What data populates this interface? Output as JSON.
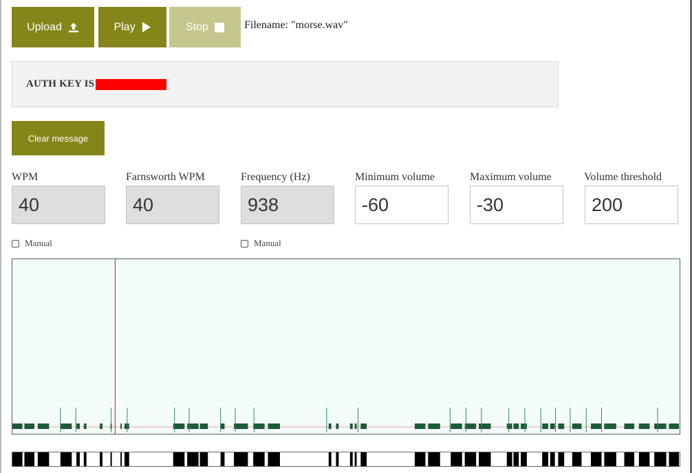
{
  "toolbar": {
    "upload_label": "Upload",
    "upload_icon": "upload-icon",
    "play_label": "Play",
    "play_icon": "play-icon",
    "stop_label": "Stop",
    "stop_icon": "stop-icon",
    "filename_text": "Filename: \"morse.wav\""
  },
  "message": {
    "text": "AUTH KEY IS",
    "redacted": true
  },
  "clear_button_label": "Clear message",
  "fields": {
    "wpm": {
      "label": "WPM",
      "value": "40",
      "readonly": true
    },
    "farnsworth": {
      "label": "Farnsworth WPM",
      "value": "40",
      "readonly": true
    },
    "frequency": {
      "label": "Frequency (Hz)",
      "value": "938",
      "readonly": true
    },
    "min_volume": {
      "label": "Minimum volume",
      "value": "-60",
      "readonly": false
    },
    "max_volume": {
      "label": "Maximum volume",
      "value": "-30",
      "readonly": false
    },
    "threshold": {
      "label": "Volume threshold",
      "value": "200",
      "readonly": false
    }
  },
  "manual_wpm_label": "Manual",
  "manual_freq_label": "Manual",
  "colors": {
    "button": "#85861a",
    "button_disabled": "#c5c68e",
    "signal": "#1d5a37",
    "spike": "#2f8a5a",
    "cursor": "#b22222",
    "threshold_line": "#f0a0a0",
    "redaction": "#ff0000"
  },
  "timeline": {
    "playhead_fraction": 0.154,
    "segments": [
      [
        0.0,
        0.015
      ],
      [
        0.018,
        0.033
      ],
      [
        0.038,
        0.055
      ],
      [
        0.072,
        0.089
      ],
      [
        0.096,
        0.101
      ],
      [
        0.107,
        0.111
      ],
      [
        0.131,
        0.135
      ],
      [
        0.147,
        0.149
      ],
      [
        0.162,
        0.164
      ],
      [
        0.168,
        0.175
      ],
      [
        0.241,
        0.258
      ],
      [
        0.262,
        0.279
      ],
      [
        0.281,
        0.293
      ],
      [
        0.312,
        0.318
      ],
      [
        0.332,
        0.353
      ],
      [
        0.361,
        0.378
      ],
      [
        0.383,
        0.401
      ],
      [
        0.474,
        0.478
      ],
      [
        0.485,
        0.489
      ],
      [
        0.506,
        0.51
      ],
      [
        0.513,
        0.516
      ],
      [
        0.522,
        0.531
      ],
      [
        0.603,
        0.619
      ],
      [
        0.623,
        0.641
      ],
      [
        0.657,
        0.674
      ],
      [
        0.678,
        0.695
      ],
      [
        0.699,
        0.717
      ],
      [
        0.741,
        0.749
      ],
      [
        0.751,
        0.759
      ],
      [
        0.762,
        0.771
      ],
      [
        0.794,
        0.803
      ],
      [
        0.806,
        0.813
      ],
      [
        0.818,
        0.827
      ],
      [
        0.839,
        0.853
      ],
      [
        0.867,
        0.883
      ],
      [
        0.887,
        0.905
      ],
      [
        0.917,
        0.932
      ],
      [
        0.939,
        0.955
      ],
      [
        0.962,
        0.98
      ],
      [
        0.984,
        0.999
      ]
    ],
    "spikes": [
      0.072,
      0.095,
      0.148,
      0.172,
      0.243,
      0.265,
      0.312,
      0.334,
      0.362,
      0.471,
      0.518,
      0.656,
      0.68,
      0.703,
      0.744,
      0.768,
      0.792,
      0.814,
      0.836,
      0.86,
      0.883,
      0.967
    ]
  }
}
